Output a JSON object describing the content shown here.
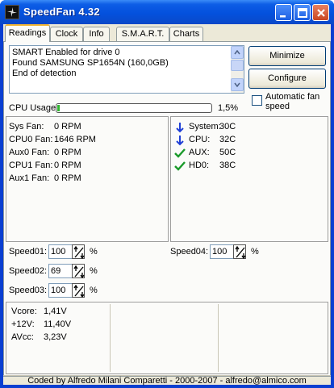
{
  "window": {
    "title": "SpeedFan 4.32",
    "icon": "fan-icon",
    "controls": {
      "minimize": "minimize-icon",
      "maximize": "maximize-icon",
      "close": "close-icon"
    }
  },
  "tabs": [
    {
      "label": "Readings",
      "active": true
    },
    {
      "label": "Clock"
    },
    {
      "label": "Info"
    },
    {
      "label": "S.M.A.R.T."
    },
    {
      "label": "Charts"
    }
  ],
  "log": {
    "lines": [
      "SMART Enabled for drive 0",
      "Found SAMSUNG SP1654N (160,0GB)",
      "End of detection"
    ]
  },
  "buttons": {
    "minimize": "Minimize",
    "configure": "Configure"
  },
  "auto_fan": {
    "label": "Automatic fan speed",
    "checked": false
  },
  "cpu_usage": {
    "label": "CPU Usage",
    "value_text": "1,5%",
    "percent": 1.5
  },
  "fans": [
    {
      "name": "Sys Fan:",
      "value": "0 RPM"
    },
    {
      "name": "CPU0 Fan:",
      "value": "1646 RPM"
    },
    {
      "name": "Aux0 Fan:",
      "value": "0 RPM"
    },
    {
      "name": "CPU1 Fan:",
      "value": "0 RPM"
    },
    {
      "name": "Aux1 Fan:",
      "value": "0 RPM"
    }
  ],
  "temps": [
    {
      "name": "System:",
      "value": "30C",
      "icon": "arrow-down-icon",
      "color": "#1f3fd6"
    },
    {
      "name": "CPU:",
      "value": "32C",
      "icon": "arrow-down-icon",
      "color": "#1f3fd6"
    },
    {
      "name": "AUX:",
      "value": "50C",
      "icon": "checkmark-icon",
      "color": "#1a9a2a"
    },
    {
      "name": "HD0:",
      "value": "38C",
      "icon": "checkmark-icon",
      "color": "#1a9a2a"
    }
  ],
  "speeds": [
    {
      "label": "Speed01:",
      "value": "100"
    },
    {
      "label": "Speed02:",
      "value": "69"
    },
    {
      "label": "Speed03:",
      "value": "100"
    },
    {
      "label": "Speed04:",
      "value": "100"
    }
  ],
  "percent_sign": "%",
  "voltages": [
    {
      "name": "Vcore:",
      "value": "1,41V"
    },
    {
      "name": "+12V:",
      "value": "11,40V"
    },
    {
      "name": "AVcc:",
      "value": "3,23V"
    }
  ],
  "footer": "Coded by Alfredo Milani Comparetti - 2000-2007 - alfredo@almico.com",
  "colors": {
    "titlebar": "#0451dd",
    "tab_highlight": "#f1b534",
    "cpu_bar": "#2fb52f"
  }
}
